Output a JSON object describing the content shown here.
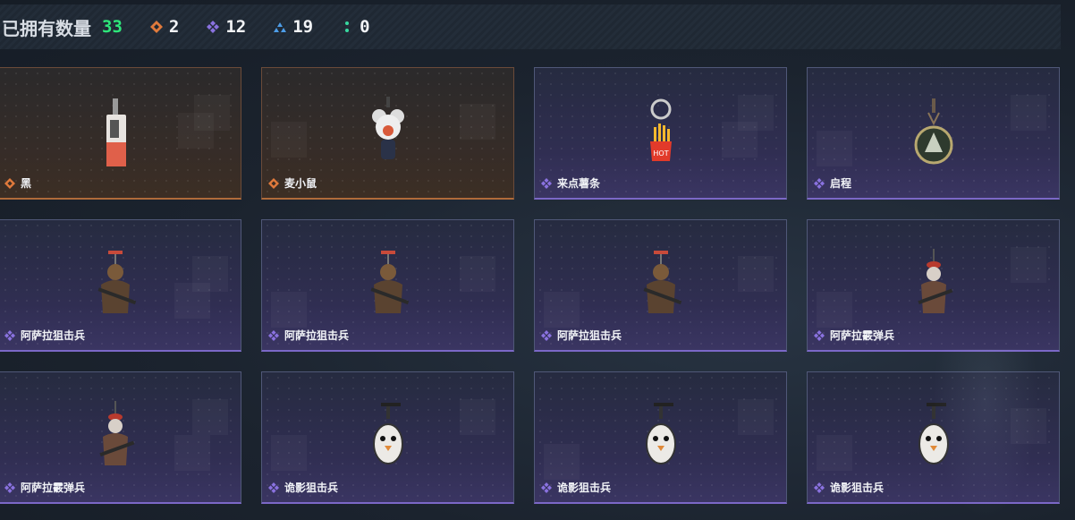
{
  "header": {
    "title": "已拥有数量",
    "total": "33",
    "stats": [
      {
        "icon": "orange-diamond-icon",
        "value": "2",
        "color": "#e07a3c"
      },
      {
        "icon": "purple-diamond-icon",
        "value": "12",
        "color": "#8a72e0"
      },
      {
        "icon": "blue-triangle-icon",
        "value": "19",
        "color": "#4d9de8"
      },
      {
        "icon": "green-dots-icon",
        "value": "0",
        "color": "#38d9a0"
      }
    ]
  },
  "items": [
    {
      "name": "黑",
      "rarity": "orange",
      "icon": "black-box-charm-icon"
    },
    {
      "name": "麦小鼠",
      "rarity": "orange",
      "icon": "mouse-charm-icon"
    },
    {
      "name": "来点薯条",
      "rarity": "purple",
      "icon": "fries-charm-icon"
    },
    {
      "name": "启程",
      "rarity": "purple",
      "icon": "medal-charm-icon"
    },
    {
      "name": "阿萨拉狙击兵",
      "rarity": "purple",
      "icon": "sniper-charm-icon"
    },
    {
      "name": "阿萨拉狙击兵",
      "rarity": "purple",
      "icon": "sniper-charm-icon"
    },
    {
      "name": "阿萨拉狙击兵",
      "rarity": "purple",
      "icon": "sniper-charm-icon"
    },
    {
      "name": "阿萨拉霰弹兵",
      "rarity": "purple",
      "icon": "shotgunner-charm-icon"
    },
    {
      "name": "阿萨拉霰弹兵",
      "rarity": "purple",
      "icon": "shotgunner-charm-icon"
    },
    {
      "name": "诡影狙击兵",
      "rarity": "purple",
      "icon": "goose-charm-icon"
    },
    {
      "name": "诡影狙击兵",
      "rarity": "purple",
      "icon": "goose-charm-icon"
    },
    {
      "name": "诡影狙击兵",
      "rarity": "purple",
      "icon": "goose-charm-icon"
    }
  ]
}
